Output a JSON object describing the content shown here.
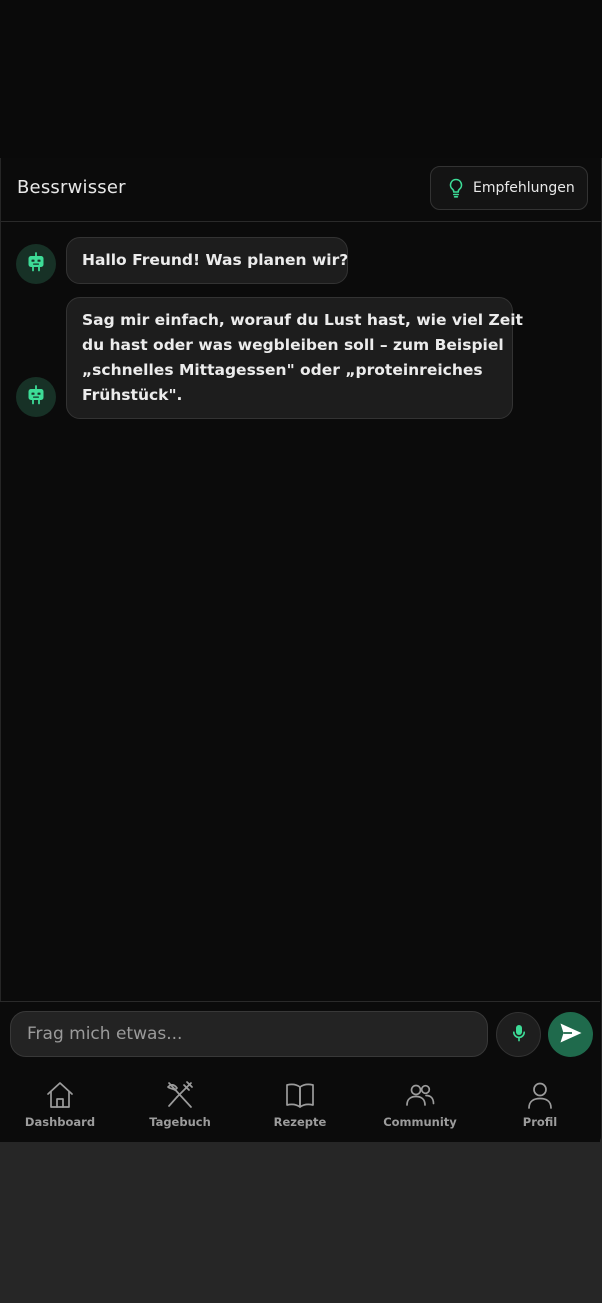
{
  "header": {
    "title": "Bessrwisser",
    "recommendations_label": "Empfehlungen",
    "recommendations_icon": "lightbulb-icon"
  },
  "colors": {
    "accent": "#3ddc97",
    "accent_dark": "#1f6a4c",
    "background": "#0b0b0b",
    "bubble": "#1d1d1d"
  },
  "messages": [
    {
      "sender": "bot",
      "avatar_icon": "robot-icon",
      "text": "Hallo Freund! Was planen wir?"
    },
    {
      "sender": "bot",
      "avatar_icon": "robot-icon",
      "lines": [
        "Sag mir einfach, worauf du Lust hast, wie viel Zeit",
        "du hast oder was wegbleiben soll – zum Beispiel",
        "„schnelles Mittagessen\" oder „proteinreiches",
        "Frühstück\"."
      ]
    }
  ],
  "composer": {
    "placeholder": "Frag mich etwas...",
    "value": "",
    "mic_icon": "microphone-icon",
    "send_icon": "send-icon"
  },
  "nav": {
    "items": [
      {
        "label": "Dashboard",
        "icon": "home-icon"
      },
      {
        "label": "Tagebuch",
        "icon": "utensils-icon"
      },
      {
        "label": "Rezepte",
        "icon": "book-icon"
      },
      {
        "label": "Community",
        "icon": "users-icon"
      },
      {
        "label": "Profil",
        "icon": "user-icon"
      }
    ]
  }
}
